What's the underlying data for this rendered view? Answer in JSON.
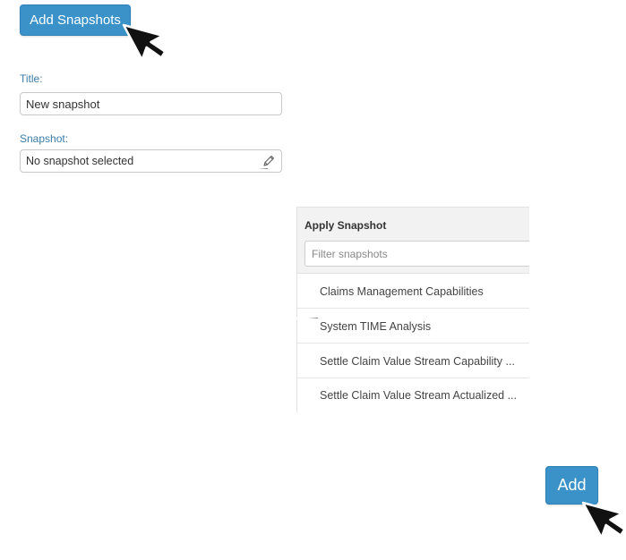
{
  "toolbar": {
    "add_snapshot_label": "Add Snapshots"
  },
  "form": {
    "title_label": "Title:",
    "title_value": "New snapshot",
    "snapshot_label": "Snapshot:",
    "snapshot_value": "No snapshot selected",
    "edit_icon": "pencil-icon"
  },
  "apply_panel": {
    "title": "Apply Snapshot",
    "filter_placeholder": "Filter snapshots",
    "items": [
      {
        "label": "Claims Management Capabilities"
      },
      {
        "label": "System TIME Analysis"
      },
      {
        "label": "Settle Claim Value Stream Capability ..."
      },
      {
        "label": "Settle Claim Value Stream Actualized ..."
      }
    ]
  },
  "footer": {
    "add_label": "Add"
  },
  "colors": {
    "accent": "#3a92c8",
    "label": "#3a7ca5",
    "panel_header": "#f2f2f2"
  },
  "cursor_icon": "arrow-cursor-icon"
}
